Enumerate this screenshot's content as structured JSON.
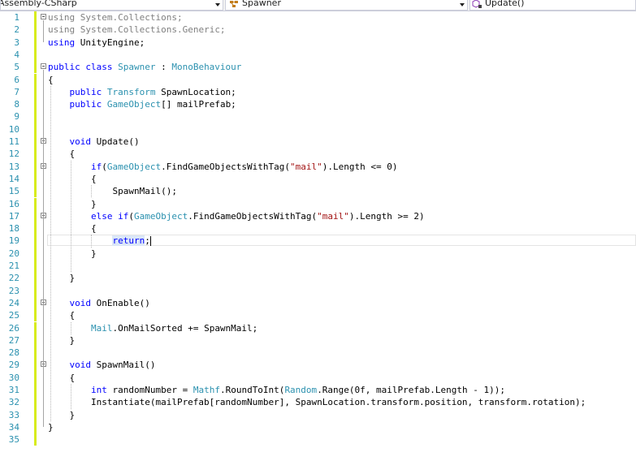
{
  "navbar": {
    "project": "Assembly-CSharp",
    "class": "Spawner",
    "member": "Update()"
  },
  "editor": {
    "lines": [
      {
        "n": "1",
        "tokens": [
          {
            "t": "using ",
            "c": "gr"
          },
          {
            "t": "System.Collections;",
            "c": "gr"
          }
        ]
      },
      {
        "n": "2",
        "tokens": [
          {
            "t": "using ",
            "c": "gr"
          },
          {
            "t": "System.Collections.Generic;",
            "c": "gr"
          }
        ]
      },
      {
        "n": "3",
        "tokens": [
          {
            "t": "using ",
            "c": "kw"
          },
          {
            "t": "UnityEngine;",
            "c": ""
          }
        ]
      },
      {
        "n": "4",
        "tokens": []
      },
      {
        "n": "5",
        "tokens": [
          {
            "t": "public class ",
            "c": "kw"
          },
          {
            "t": "Spawner",
            "c": "ty"
          },
          {
            "t": " : ",
            "c": ""
          },
          {
            "t": "MonoBehaviour",
            "c": "ty"
          }
        ]
      },
      {
        "n": "6",
        "tokens": [
          {
            "t": "{",
            "c": ""
          }
        ]
      },
      {
        "n": "7",
        "tokens": [
          {
            "t": "    public ",
            "c": "kw"
          },
          {
            "t": "Transform",
            "c": "ty"
          },
          {
            "t": " SpawnLocation;",
            "c": ""
          }
        ]
      },
      {
        "n": "8",
        "tokens": [
          {
            "t": "    public ",
            "c": "kw"
          },
          {
            "t": "GameObject",
            "c": "ty"
          },
          {
            "t": "[] mailPrefab;",
            "c": ""
          }
        ]
      },
      {
        "n": "9",
        "tokens": []
      },
      {
        "n": "10",
        "tokens": []
      },
      {
        "n": "11",
        "tokens": [
          {
            "t": "    void ",
            "c": "kw"
          },
          {
            "t": "Update()",
            "c": ""
          }
        ]
      },
      {
        "n": "12",
        "tokens": [
          {
            "t": "    {",
            "c": ""
          }
        ]
      },
      {
        "n": "13",
        "tokens": [
          {
            "t": "        if",
            "c": "kw"
          },
          {
            "t": "(",
            "c": ""
          },
          {
            "t": "GameObject",
            "c": "ty"
          },
          {
            "t": ".FindGameObjectsWithTag(",
            "c": ""
          },
          {
            "t": "\"mail\"",
            "c": "st"
          },
          {
            "t": ").Length <= 0)",
            "c": ""
          }
        ]
      },
      {
        "n": "14",
        "tokens": [
          {
            "t": "        {",
            "c": ""
          }
        ]
      },
      {
        "n": "15",
        "tokens": [
          {
            "t": "            SpawnMail();",
            "c": ""
          }
        ]
      },
      {
        "n": "16",
        "tokens": [
          {
            "t": "        }",
            "c": ""
          }
        ]
      },
      {
        "n": "17",
        "tokens": [
          {
            "t": "        else if",
            "c": "kw"
          },
          {
            "t": "(",
            "c": ""
          },
          {
            "t": "GameObject",
            "c": "ty"
          },
          {
            "t": ".FindGameObjectsWithTag(",
            "c": ""
          },
          {
            "t": "\"mail\"",
            "c": "st"
          },
          {
            "t": ").Length >= 2)",
            "c": ""
          }
        ]
      },
      {
        "n": "18",
        "tokens": [
          {
            "t": "        {",
            "c": ""
          }
        ]
      },
      {
        "n": "19",
        "tokens": [
          {
            "t": "            ",
            "c": ""
          },
          {
            "t": "return",
            "c": "kw hl-return"
          },
          {
            "t": ";",
            "c": ""
          }
        ],
        "current": true
      },
      {
        "n": "20",
        "tokens": [
          {
            "t": "        }",
            "c": ""
          }
        ]
      },
      {
        "n": "21",
        "tokens": []
      },
      {
        "n": "22",
        "tokens": [
          {
            "t": "    }",
            "c": ""
          }
        ]
      },
      {
        "n": "23",
        "tokens": []
      },
      {
        "n": "24",
        "tokens": [
          {
            "t": "    void ",
            "c": "kw"
          },
          {
            "t": "OnEnable()",
            "c": ""
          }
        ]
      },
      {
        "n": "25",
        "tokens": [
          {
            "t": "    {",
            "c": ""
          }
        ]
      },
      {
        "n": "26",
        "tokens": [
          {
            "t": "        Mail",
            "c": "ty"
          },
          {
            "t": ".OnMailSorted += SpawnMail;",
            "c": ""
          }
        ]
      },
      {
        "n": "27",
        "tokens": [
          {
            "t": "    }",
            "c": ""
          }
        ]
      },
      {
        "n": "28",
        "tokens": []
      },
      {
        "n": "29",
        "tokens": [
          {
            "t": "    void ",
            "c": "kw"
          },
          {
            "t": "SpawnMail()",
            "c": ""
          }
        ]
      },
      {
        "n": "30",
        "tokens": [
          {
            "t": "    {",
            "c": ""
          }
        ]
      },
      {
        "n": "31",
        "tokens": [
          {
            "t": "        int ",
            "c": "kw"
          },
          {
            "t": "randomNumber = ",
            "c": ""
          },
          {
            "t": "Mathf",
            "c": "ty"
          },
          {
            "t": ".RoundToInt(",
            "c": ""
          },
          {
            "t": "Random",
            "c": "ty"
          },
          {
            "t": ".Range(0f, mailPrefab.Length - 1));",
            "c": ""
          }
        ]
      },
      {
        "n": "32",
        "tokens": [
          {
            "t": "        Instantiate(mailPrefab[randomNumber], SpawnLocation.transform.position, transform.rotation);",
            "c": ""
          }
        ]
      },
      {
        "n": "33",
        "tokens": [
          {
            "t": "    }",
            "c": ""
          }
        ]
      },
      {
        "n": "34",
        "tokens": [
          {
            "t": "}",
            "c": ""
          }
        ]
      },
      {
        "n": "35",
        "tokens": []
      }
    ]
  }
}
